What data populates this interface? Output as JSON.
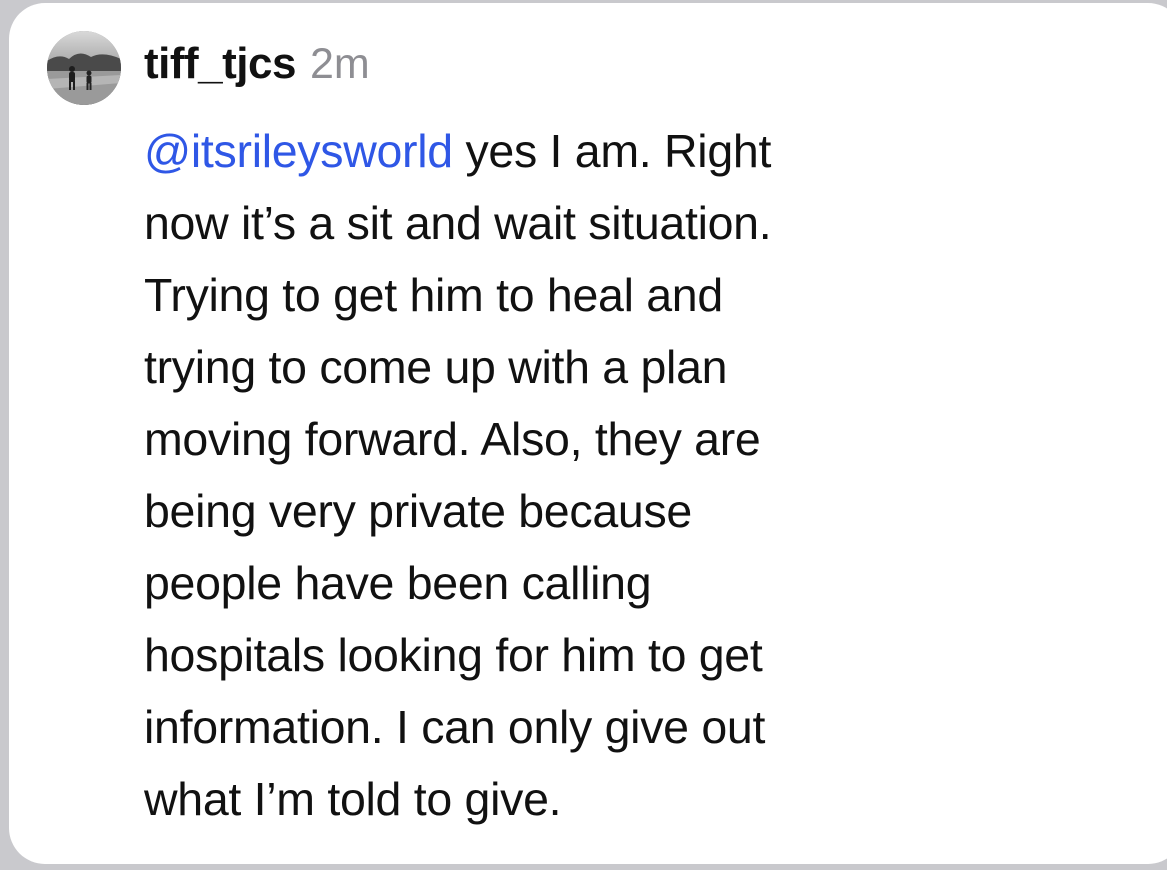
{
  "comment": {
    "username": "tiff_tjcs",
    "timestamp": "2m",
    "mention": "@itsrileysworld",
    "lines": [
      " yes I am. Right",
      "now it’s a sit and wait situation.",
      "Trying to get him to heal and",
      "trying to come up with a plan",
      "moving forward. Also, they are",
      "being very private because",
      "people have been calling",
      "hospitals looking for him to get",
      "information. I can only give out",
      "what I’m told to give."
    ]
  },
  "colors": {
    "background": "#c9c9cd",
    "card": "#ffffff",
    "text": "#111111",
    "timestamp": "#8e8e93",
    "mention": "#2f57e6"
  },
  "icons": {
    "avatar": "profile-photo-people-walking"
  }
}
